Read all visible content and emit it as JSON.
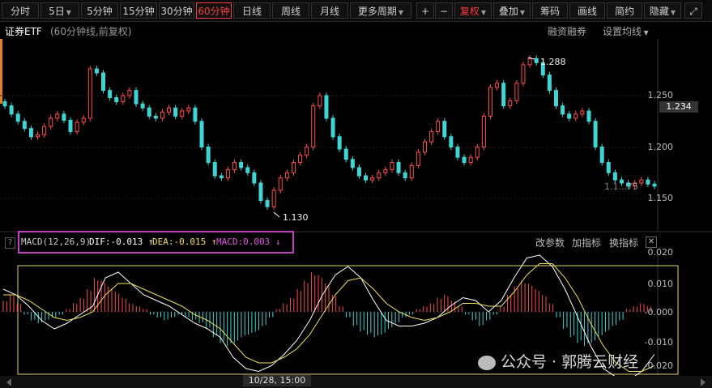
{
  "toolbar": {
    "tabs": [
      "分时",
      "5日",
      "5分钟",
      "15分钟",
      "30分钟",
      "60分钟",
      "日线",
      "周线",
      "月线",
      "更多周期"
    ],
    "active_tab": "60分钟",
    "plus": "+",
    "minus": "−",
    "fuquan": "复权",
    "overlay": "叠加",
    "chips": "筹码",
    "draw": "画线",
    "simple": "简约",
    "hide": "隐藏"
  },
  "title": {
    "name": "证券ETF",
    "desc": "(60分钟线,前复权)",
    "margin": "融资融券",
    "ma_setting": "设置均线"
  },
  "price_axis": [
    "1.250",
    "1.200",
    "1.150"
  ],
  "current_price": "1.234",
  "annotations": {
    "high": "1.288",
    "low": "1.130",
    "right_partial": "1.1...75"
  },
  "macd_legend": {
    "name": "MACD(12,26,9)",
    "dif_label": "DIF:",
    "dif_value": "-0.013",
    "dif_arrow": "↑",
    "dea_label": "DEA:",
    "dea_value": "-0.015",
    "dea_arrow": "↑",
    "macd_label": "MACD:",
    "macd_value": "0.003",
    "macd_arrow": "↓"
  },
  "indicator_buttons": {
    "change_params": "改参数",
    "add": "加指标",
    "switch": "换指标",
    "close": "✕",
    "help": "?"
  },
  "macd_axis": [
    "0.020",
    "0.010",
    "-0.000",
    "-0.010",
    "-0.020"
  ],
  "time_cursor": "10/28, 15:00",
  "watermark": "公众号 · 郭腾云财经",
  "colors": {
    "up": "#ff4d4d",
    "down": "#3ed5d5",
    "dif": "#ffffff",
    "dea": "#f2e05a",
    "macd_box": "#c040c0"
  },
  "chart_data": {
    "type": "candlestick",
    "price_range": [
      1.13,
      1.288
    ],
    "candle_closes": [
      1.24,
      1.232,
      1.225,
      1.218,
      1.21,
      1.212,
      1.22,
      1.228,
      1.232,
      1.226,
      1.215,
      1.224,
      1.228,
      1.276,
      1.272,
      1.255,
      1.248,
      1.244,
      1.25,
      1.255,
      1.242,
      1.238,
      1.23,
      1.228,
      1.234,
      1.238,
      1.23,
      1.235,
      1.238,
      1.225,
      1.2,
      1.185,
      1.172,
      1.17,
      1.178,
      1.185,
      1.18,
      1.175,
      1.165,
      1.148,
      1.142,
      1.158,
      1.17,
      1.175,
      1.185,
      1.192,
      1.2,
      1.24,
      1.25,
      1.228,
      1.21,
      1.198,
      1.188,
      1.18,
      1.172,
      1.168,
      1.17,
      1.175,
      1.178,
      1.185,
      1.175,
      1.17,
      1.182,
      1.195,
      1.205,
      1.215,
      1.225,
      1.21,
      1.2,
      1.19,
      1.185,
      1.19,
      1.2,
      1.23,
      1.258,
      1.262,
      1.24,
      1.245,
      1.262,
      1.28,
      1.286,
      1.282,
      1.27,
      1.255,
      1.24,
      1.232,
      1.228,
      1.232,
      1.235,
      1.225,
      1.2,
      1.185,
      1.175,
      1.168,
      1.165,
      1.162,
      1.165,
      1.168,
      1.164,
      1.162
    ],
    "macd_hist": [
      0.004,
      0.006,
      0.003,
      -0.001,
      -0.003,
      -0.004,
      -0.003,
      -0.002,
      -0.001,
      0.001,
      0.003,
      0.005,
      0.008,
      0.012,
      0.011,
      0.009,
      0.007,
      0.005,
      0.003,
      0.002,
      0.001,
      -0.001,
      -0.002,
      -0.003,
      -0.002,
      -0.001,
      -0.002,
      -0.003,
      -0.004,
      -0.006,
      -0.009,
      -0.011,
      -0.012,
      -0.011,
      -0.009,
      -0.008,
      -0.007,
      -0.005,
      -0.002,
      0.001,
      0.003,
      0.005,
      0.008,
      0.011,
      0.014,
      0.013,
      0.01,
      0.006,
      0.002,
      -0.002,
      -0.005,
      -0.007,
      -0.008,
      -0.009,
      -0.008,
      -0.006,
      -0.004,
      -0.002,
      -0.001,
      0.001,
      0.002,
      0.003,
      0.005,
      0.006,
      0.004,
      0.002,
      -0.001,
      -0.003,
      -0.005,
      -0.003,
      -0.001,
      0.002,
      0.006,
      0.009,
      0.011,
      0.01,
      0.008,
      0.006,
      0.003,
      -0.002,
      -0.006,
      -0.009,
      -0.011,
      -0.012,
      -0.011,
      -0.009,
      -0.007,
      -0.005,
      -0.003,
      0.001,
      0.002,
      0.003,
      0.002
    ],
    "dif": [
      0.008,
      0.006,
      0.002,
      -0.003,
      -0.006,
      -0.004,
      -0.001,
      0.002,
      0.012,
      0.014,
      0.01,
      0.006,
      0.004,
      0.002,
      -0.001,
      -0.004,
      -0.006,
      -0.009,
      -0.016,
      -0.02,
      -0.021,
      -0.019,
      -0.015,
      -0.01,
      -0.003,
      0.006,
      0.013,
      0.016,
      0.012,
      0.004,
      -0.003,
      -0.005,
      -0.005,
      -0.004,
      -0.002,
      0.002,
      0.005,
      0.004,
      0.0,
      0.004,
      0.012,
      0.019,
      0.02,
      0.016,
      0.008,
      -0.002,
      -0.012,
      -0.02,
      -0.023,
      -0.024,
      -0.021,
      -0.015
    ],
    "dea": [
      0.006,
      0.006,
      0.004,
      0.001,
      -0.002,
      -0.003,
      -0.002,
      0.0,
      0.006,
      0.01,
      0.01,
      0.008,
      0.006,
      0.004,
      0.002,
      -0.001,
      -0.003,
      -0.006,
      -0.011,
      -0.016,
      -0.018,
      -0.018,
      -0.016,
      -0.013,
      -0.008,
      -0.001,
      0.006,
      0.011,
      0.012,
      0.008,
      0.003,
      0.0,
      -0.002,
      -0.003,
      -0.002,
      0.0,
      0.003,
      0.003,
      0.002,
      0.002,
      0.007,
      0.013,
      0.017,
      0.017,
      0.012,
      0.005,
      -0.004,
      -0.012,
      -0.018,
      -0.021,
      -0.021,
      -0.019
    ],
    "macd_range": [
      -0.022,
      0.022
    ]
  }
}
